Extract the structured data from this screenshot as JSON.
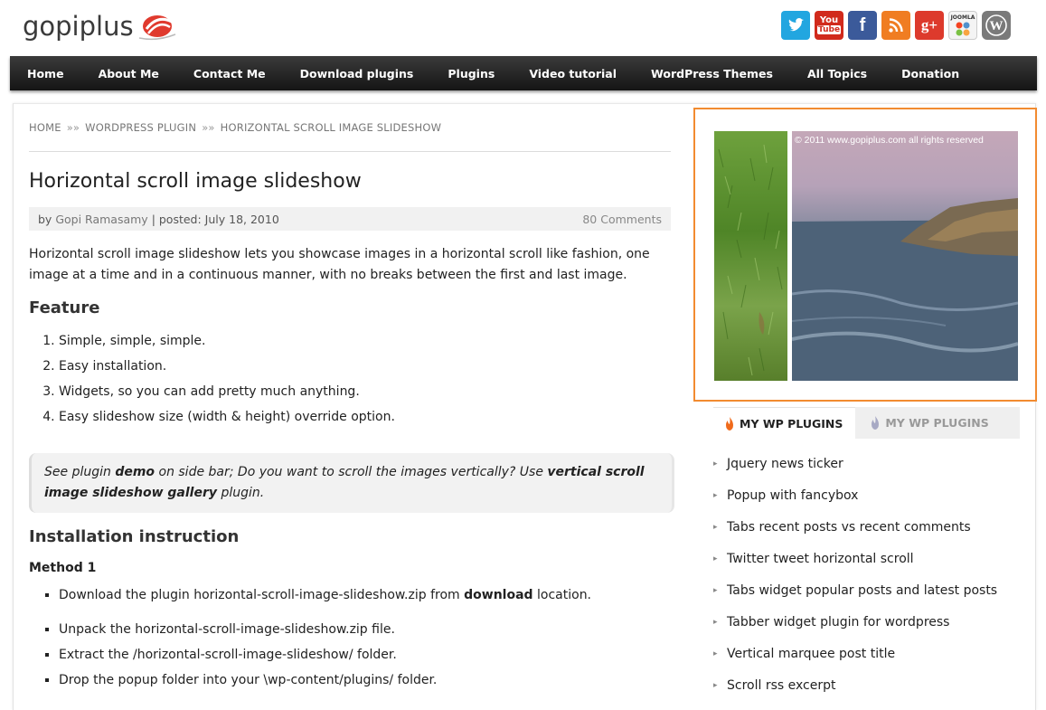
{
  "site": {
    "logo_text": "gopiplus",
    "social_icons": [
      {
        "name": "twitter-icon",
        "glyph": "t",
        "color": "#22a6e0"
      },
      {
        "name": "youtube-icon",
        "glyph": "You",
        "color": "#d12a1c"
      },
      {
        "name": "facebook-icon",
        "glyph": "f",
        "color": "#3b5a9a"
      },
      {
        "name": "rss-icon",
        "glyph": "◉",
        "color": "#f07d22"
      },
      {
        "name": "google-plus-icon",
        "glyph": "g+",
        "color": "#dd3a2c"
      },
      {
        "name": "joomla-icon",
        "glyph": "✱",
        "color": "#4a4a4a"
      },
      {
        "name": "wordpress-icon",
        "glyph": "W",
        "color": "#7a7a7a"
      }
    ]
  },
  "nav": {
    "items": [
      "Home",
      "About Me",
      "Contact Me",
      "Download plugins",
      "Plugins",
      "Video tutorial",
      "WordPress Themes",
      "All Topics",
      "Donation"
    ]
  },
  "breadcrumb": {
    "items": [
      "HOME",
      "WORDPRESS PLUGIN",
      "HORIZONTAL SCROLL IMAGE SLIDESHOW"
    ],
    "separator": "»»"
  },
  "post": {
    "title": "Horizontal scroll image slideshow",
    "meta_by": "by",
    "author": "Gopi Ramasamy",
    "posted": "| posted: July 18, 2010",
    "comments": "80 Comments",
    "intro": "Horizontal scroll image slideshow lets you showcase images in a horizontal scroll like fashion, one image at a time and in a continuous manner, with no breaks between the first and last image.",
    "feature_heading": "Feature",
    "features": [
      "Simple, simple, simple.",
      "Easy installation.",
      "Widgets, so you can add pretty much anything.",
      "Easy slideshow size (width & height) override option."
    ],
    "note": {
      "part1": "See plugin ",
      "demo": "demo",
      "part2": " on side bar; Do you want to scroll the images vertically? Use ",
      "link": "vertical scroll image slideshow gallery",
      "part3": " plugin."
    },
    "install_heading": "Installation instruction",
    "method_heading": "Method 1",
    "step1": {
      "before": "Download the plugin horizontal-scroll-image-slideshow.zip from ",
      "link": "download",
      "after": " location."
    },
    "steps": [
      "Unpack the horizontal-scroll-image-slideshow.zip file.",
      "Extract the /horizontal-scroll-image-slideshow/ folder.",
      "Drop the popup folder into your \\wp-content/plugins/ folder."
    ]
  },
  "sidebar": {
    "slideshow_copyright": "© 2011 www.gopiplus.com all rights reserved",
    "tabs": [
      "MY WP PLUGINS",
      "MY WP PLUGINS"
    ],
    "plugins": [
      "Jquery news ticker",
      "Popup with fancybox",
      "Tabs recent posts vs recent comments",
      "Twitter tweet horizontal scroll",
      "Tabs widget popular posts and latest posts",
      "Tabber widget plugin for wordpress",
      "Vertical marquee post title",
      "Scroll rss excerpt"
    ],
    "accent_color": "#f28b30"
  }
}
